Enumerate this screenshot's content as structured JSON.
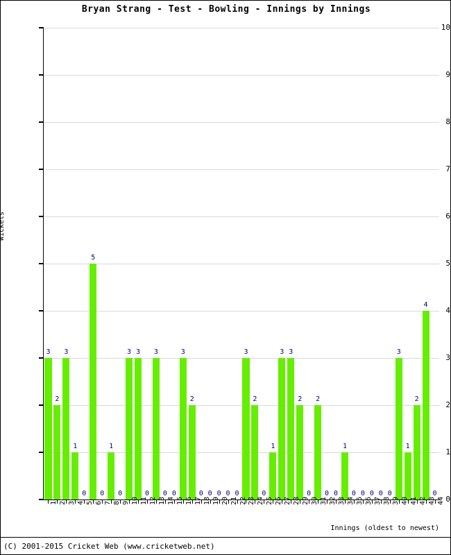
{
  "chart_data": {
    "type": "bar",
    "title": "Bryan Strang - Test - Bowling - Innings by Innings",
    "xlabel": "Innings (oldest to newest)",
    "ylabel": "Wickets",
    "ylim": [
      0,
      10
    ],
    "yticks": [
      0,
      1,
      2,
      3,
      4,
      5,
      6,
      7,
      8,
      9,
      10
    ],
    "grid": true,
    "legend": "none",
    "bar_color": "#66ee00",
    "label_color": "#000080",
    "categories": [
      "1",
      "2",
      "3",
      "4",
      "5",
      "6",
      "7",
      "8",
      "9",
      "10",
      "11",
      "12",
      "13",
      "14",
      "15",
      "16",
      "17",
      "18",
      "19",
      "20",
      "21",
      "22",
      "23",
      "24",
      "25",
      "26",
      "27",
      "28",
      "29",
      "30",
      "31",
      "32",
      "33",
      "34",
      "35",
      "36",
      "37",
      "38",
      "39",
      "40",
      "41",
      "42",
      "43",
      "44"
    ],
    "values": [
      3,
      2,
      3,
      1,
      0,
      5,
      0,
      1,
      0,
      3,
      3,
      0,
      3,
      0,
      0,
      3,
      2,
      0,
      0,
      0,
      0,
      0,
      3,
      2,
      0,
      1,
      3,
      3,
      2,
      0,
      2,
      0,
      0,
      1,
      0,
      0,
      0,
      0,
      0,
      3,
      1,
      2,
      4,
      0
    ]
  },
  "footer": {
    "copyright": "(C) 2001-2015 Cricket Web (www.cricketweb.net)"
  }
}
